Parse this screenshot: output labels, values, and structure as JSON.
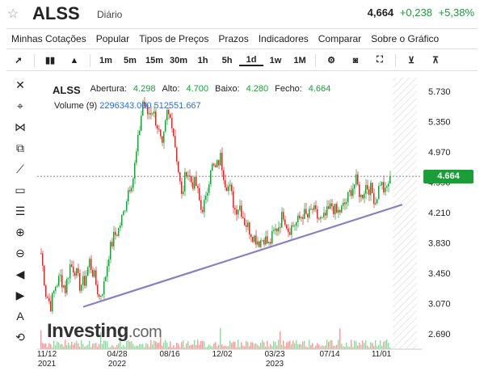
{
  "header": {
    "ticker": "ALSS",
    "period": "Diário",
    "last": "4,664",
    "change": "+0,238",
    "change_pct": "+5,38%",
    "colors": {
      "up": "#1a9e38",
      "down": "#d62a2a"
    }
  },
  "menu": [
    "Minhas Cotações",
    "Popular",
    "Tipos de Preços",
    "Prazos",
    "Indicadores",
    "Comparar",
    "Sobre o Gráfico"
  ],
  "toolbar": {
    "intervals": [
      "1m",
      "5m",
      "15m",
      "30m",
      "1h",
      "5h",
      "1d",
      "1w",
      "1M"
    ],
    "selected": "1d",
    "icons": [
      "cursor-icon",
      "candlestick-icon",
      "mountain-icon",
      "gear-icon",
      "camera-icon",
      "fullscreen-icon",
      "download-icon",
      "upload-icon"
    ]
  },
  "sidebar": [
    "close-icon",
    "crosshair-icon",
    "magnet-icon",
    "copy-icon",
    "trendline-icon",
    "rectangle-icon",
    "fib-icon",
    "zoom-in-icon",
    "zoom-out-icon",
    "arrow-left-icon",
    "arrow-right-icon",
    "text-icon",
    "reset-icon"
  ],
  "legend": {
    "symbol": "ALSS",
    "open_label": "Abertura:",
    "open": "4.298",
    "high_label": "Alto:",
    "high": "4.700",
    "low_label": "Baixo:",
    "low": "4.280",
    "close_label": "Fecho:",
    "close": "4.664",
    "volume_label": "Volume (9)",
    "volume_values": "2296343.000 512551.667"
  },
  "price_tag": "4.664",
  "logo": {
    "main": "Investing",
    "suffix": ".com"
  },
  "chart_data": {
    "type": "candlestick",
    "yaxis_ticks": [
      "5.730",
      "5.350",
      "4.970",
      "4.590",
      "4.210",
      "3.830",
      "3.450",
      "3.070",
      "2.690"
    ],
    "xaxis_ticks": [
      {
        "label": "11/12",
        "year": "2021"
      },
      {
        "label": "04/28",
        "year": "2022"
      },
      {
        "label": "08/16",
        "year": ""
      },
      {
        "label": "12/02",
        "year": ""
      },
      {
        "label": "03/23",
        "year": "2023"
      },
      {
        "label": "07/14",
        "year": ""
      },
      {
        "label": "11/01",
        "year": ""
      }
    ],
    "ylim": [
      2.5,
      5.9
    ],
    "last_price": 4.664,
    "trendline": {
      "from": {
        "date": "2022-03",
        "price": 3.03
      },
      "to": {
        "date": "2023-11",
        "price": 4.31
      }
    },
    "close_path": [
      3.7,
      3.2,
      3.05,
      3.3,
      3.4,
      3.25,
      3.55,
      3.5,
      3.3,
      3.35,
      3.6,
      3.4,
      3.15,
      3.3,
      3.7,
      3.9,
      4.0,
      4.2,
      4.5,
      4.65,
      5.1,
      5.6,
      5.45,
      5.5,
      5.3,
      5.0,
      5.45,
      5.35,
      4.9,
      4.4,
      4.75,
      4.6,
      4.55,
      4.25,
      4.35,
      4.8,
      4.75,
      4.9,
      4.6,
      4.5,
      4.25,
      4.3,
      4.1,
      4.0,
      3.9,
      3.85,
      3.9,
      3.8,
      3.95,
      4.05,
      4.2,
      4.0,
      4.05,
      4.1,
      4.2,
      4.15,
      4.25,
      4.15,
      4.1,
      4.2,
      4.3,
      4.2,
      4.25,
      4.35,
      4.5,
      4.6,
      4.4,
      4.55,
      4.5,
      4.35,
      4.6,
      4.45,
      4.664
    ]
  }
}
